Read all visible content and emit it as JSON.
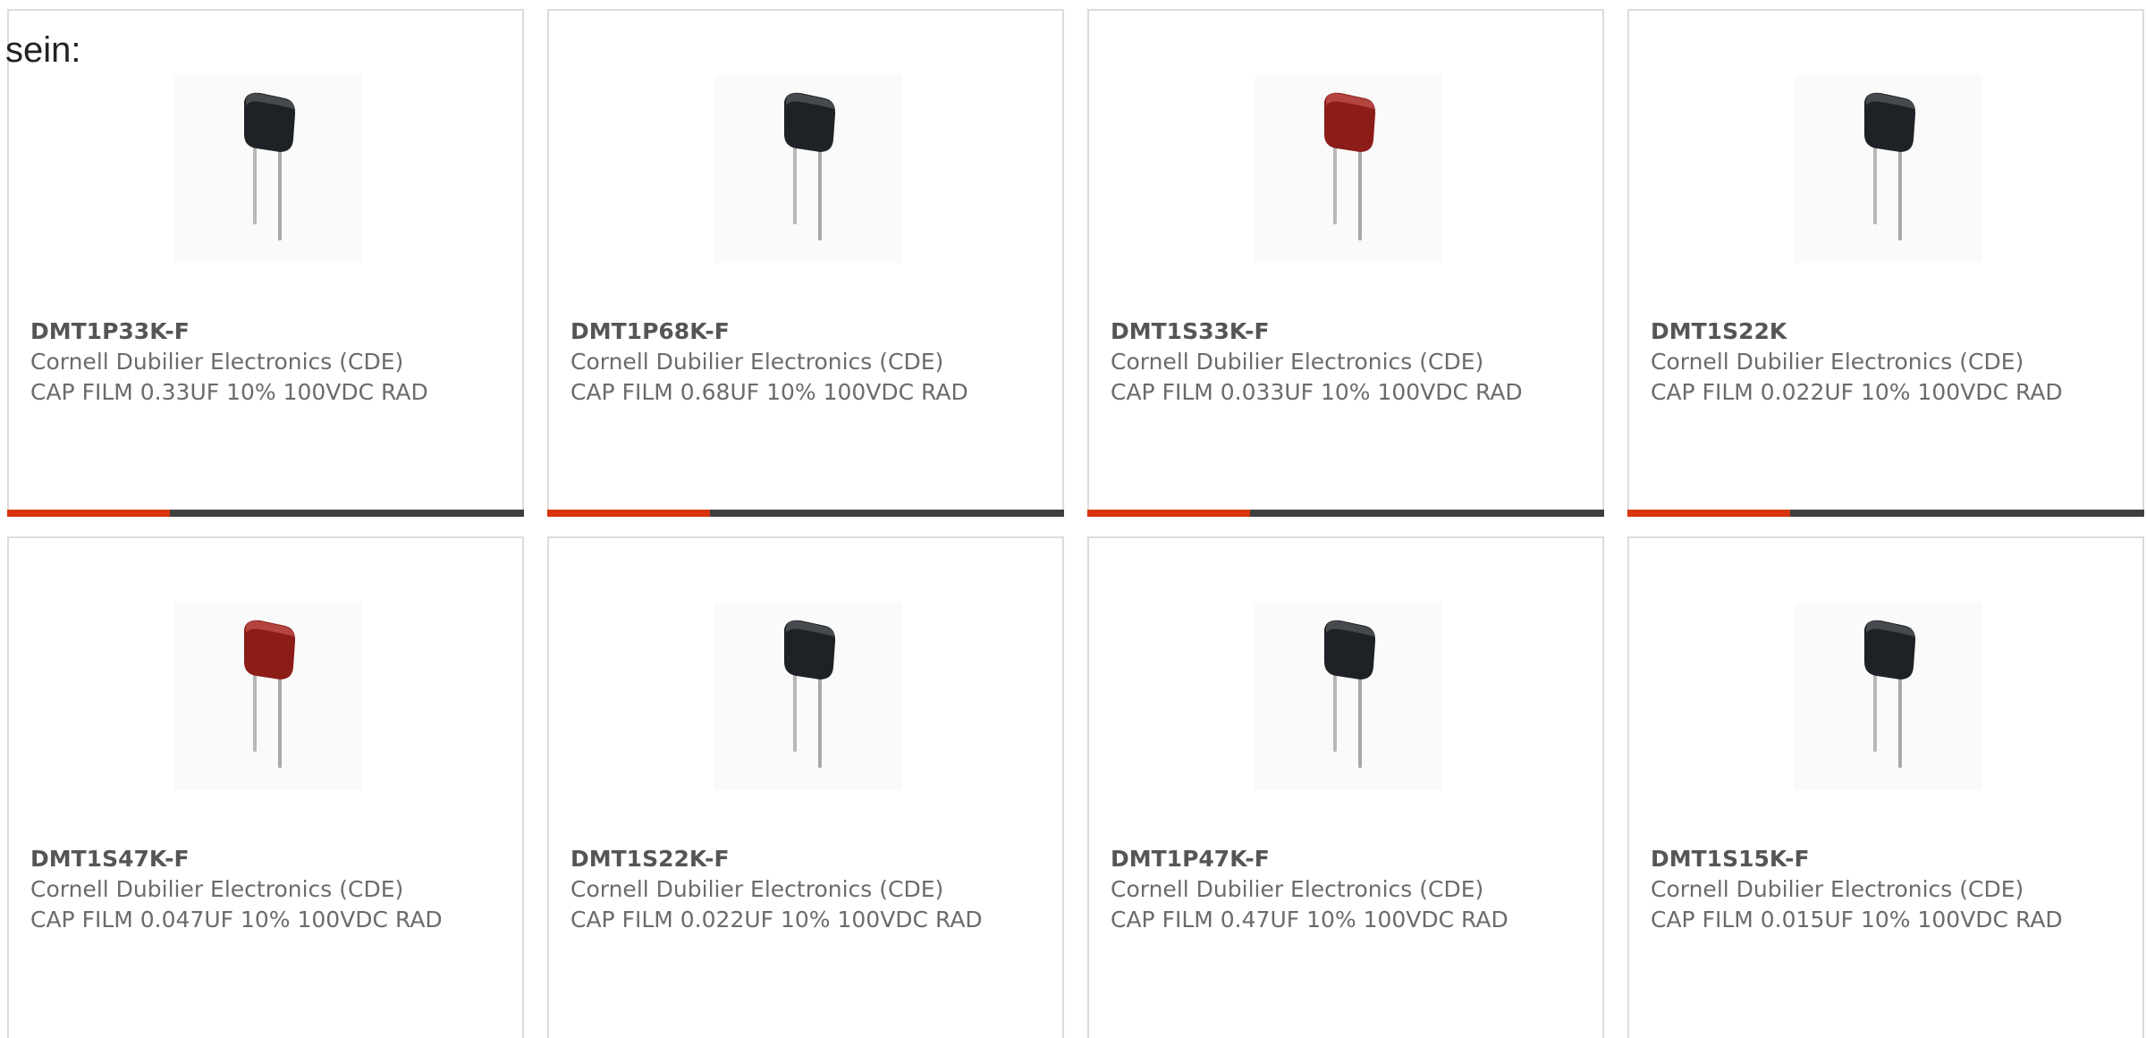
{
  "intro": "sein:",
  "colors": {
    "accent": "#d8350f",
    "bar_dark": "#3f3f3f",
    "cap_dark": "#1e2226",
    "cap_red": "#8b1c17"
  },
  "products": [
    {
      "part": "DMT1P33K-F",
      "maker": "Cornell Dubilier Electronics (CDE)",
      "desc": "CAP FILM 0.33UF 10% 100VDC RAD",
      "image_icon": "capacitor-black-icon",
      "cap_color": "#1e2226",
      "bar_fill_pct": 31.5
    },
    {
      "part": "DMT1P68K-F",
      "maker": "Cornell Dubilier Electronics (CDE)",
      "desc": "CAP FILM 0.68UF 10% 100VDC RAD",
      "image_icon": "capacitor-black-icon",
      "cap_color": "#1e2226",
      "bar_fill_pct": 31.5
    },
    {
      "part": "DMT1S33K-F",
      "maker": "Cornell Dubilier Electronics (CDE)",
      "desc": "CAP FILM 0.033UF 10% 100VDC RAD",
      "image_icon": "capacitor-red-icon",
      "cap_color": "#8b1c17",
      "bar_fill_pct": 31.5
    },
    {
      "part": "DMT1S22K",
      "maker": "Cornell Dubilier Electronics (CDE)",
      "desc": "CAP FILM 0.022UF 10% 100VDC RAD",
      "image_icon": "capacitor-black-icon",
      "cap_color": "#1e2226",
      "bar_fill_pct": 31.5
    },
    {
      "part": "DMT1S47K-F",
      "maker": "Cornell Dubilier Electronics (CDE)",
      "desc": "CAP FILM 0.047UF 10% 100VDC RAD",
      "image_icon": "capacitor-red-icon",
      "cap_color": "#8b1c17",
      "bar_fill_pct": 0
    },
    {
      "part": "DMT1S22K-F",
      "maker": "Cornell Dubilier Electronics (CDE)",
      "desc": "CAP FILM 0.022UF 10% 100VDC RAD",
      "image_icon": "capacitor-black-icon",
      "cap_color": "#1e2226",
      "bar_fill_pct": 0
    },
    {
      "part": "DMT1P47K-F",
      "maker": "Cornell Dubilier Electronics (CDE)",
      "desc": "CAP FILM 0.47UF 10% 100VDC RAD",
      "image_icon": "capacitor-black-icon",
      "cap_color": "#1e2226",
      "bar_fill_pct": 0
    },
    {
      "part": "DMT1S15K-F",
      "maker": "Cornell Dubilier Electronics (CDE)",
      "desc": "CAP FILM 0.015UF 10% 100VDC RAD",
      "image_icon": "capacitor-black-icon",
      "cap_color": "#1e2226",
      "bar_fill_pct": 0
    }
  ]
}
